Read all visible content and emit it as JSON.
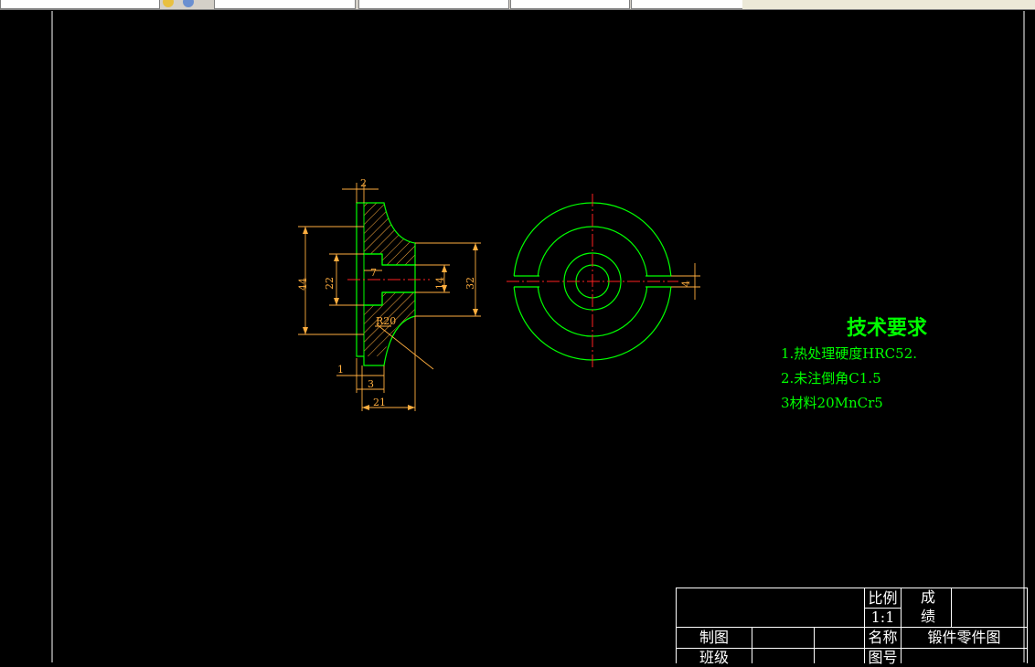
{
  "toolbar": {
    "field1": "",
    "field2": "",
    "field3": "",
    "field4": "",
    "field5": ""
  },
  "drawing": {
    "dimensions": {
      "d_2": "2",
      "d_44": "44",
      "d_22": "22",
      "d_7": "7",
      "d_14": "14",
      "d_32": "32",
      "d_r20": "R20",
      "d_1": "1",
      "d_3": "3",
      "d_21": "21",
      "d_4": "4"
    },
    "colors": {
      "outline": "#00ff00",
      "dimension": "#ffae3f",
      "centerline": "#ff2020",
      "hatch": "#ffae3f",
      "frame": "#ffffff"
    }
  },
  "notes": {
    "title": "技术要求",
    "items": [
      "1.热处理硬度HRC52.",
      "2.未注倒角C1.5",
      "3材料20MnCr5"
    ]
  },
  "title_block": {
    "scale_label": "比例",
    "scale_value": "1:1",
    "grade_label_1": "成",
    "grade_label_2": "绩",
    "drawn_by_label": "制图",
    "name_label": "名称",
    "name_value": "锻件零件图",
    "class_label": "班级",
    "drawing_no_label": "图号"
  }
}
